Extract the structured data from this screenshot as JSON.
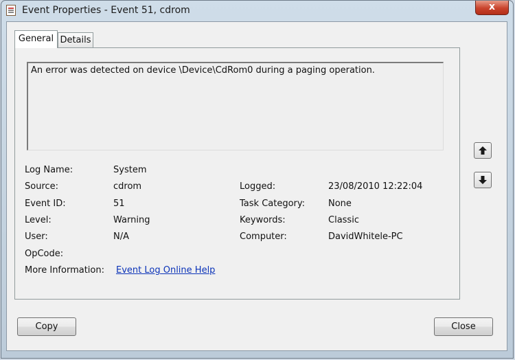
{
  "window": {
    "title": "Event Properties - Event 51, cdrom",
    "close_label": "x"
  },
  "tabs": [
    {
      "label": "General",
      "selected": true
    },
    {
      "label": "Details",
      "selected": false
    }
  ],
  "description": "An error was detected on device \\Device\\CdRom0 during a paging operation.",
  "fields": {
    "log_name": {
      "label": "Log Name:",
      "value": "System"
    },
    "source": {
      "label": "Source:",
      "value": "cdrom"
    },
    "event_id": {
      "label": "Event ID:",
      "value": "51"
    },
    "level": {
      "label": "Level:",
      "value": "Warning"
    },
    "user": {
      "label": "User:",
      "value": "N/A"
    },
    "opcode": {
      "label": "OpCode:",
      "value": ""
    },
    "more_info": {
      "label": "More Information:",
      "value": "Event Log Online Help"
    },
    "logged": {
      "label": "Logged:",
      "value": "23/08/2010 12:22:04"
    },
    "task_category": {
      "label": "Task Category:",
      "value": "None"
    },
    "keywords": {
      "label": "Keywords:",
      "value": "Classic"
    },
    "computer": {
      "label": "Computer:",
      "value": "DavidWhitele-PC"
    }
  },
  "buttons": {
    "copy": "Copy",
    "close": "Close",
    "up_icon": "arrow-up-icon",
    "down_icon": "arrow-down-icon"
  }
}
